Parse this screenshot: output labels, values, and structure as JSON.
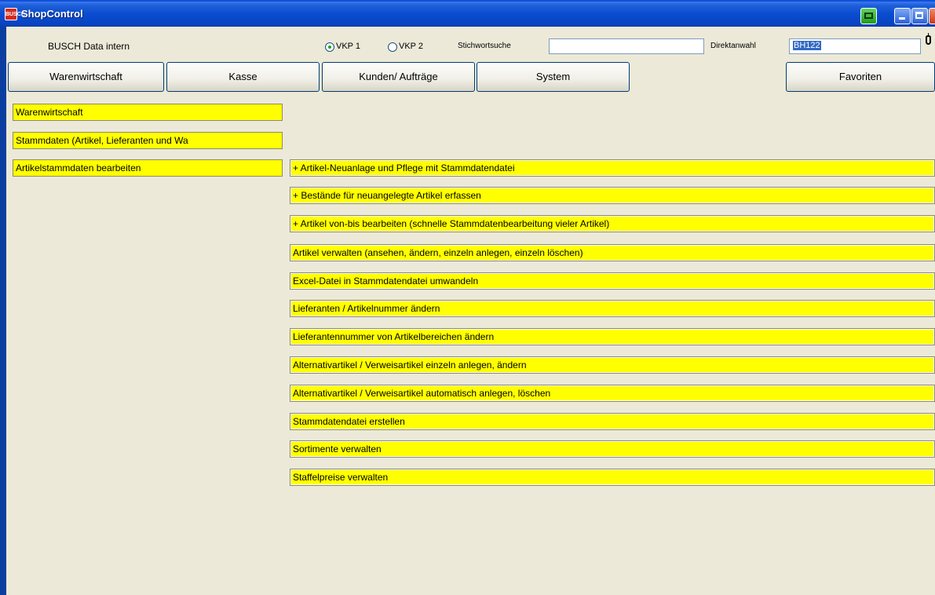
{
  "window": {
    "title": "ShopControl",
    "icon": "shopcontrol-app-icon",
    "app_icon_text": "BUSCH"
  },
  "header": {
    "company": "BUSCH Data intern",
    "price_options": [
      {
        "label": "VKP 1",
        "selected": true
      },
      {
        "label": "VKP 2",
        "selected": false
      }
    ],
    "search_label": "Stichwortsuche",
    "search_value": "",
    "direct_label": "Direktanwahl",
    "direct_value": "BH122"
  },
  "tabs": [
    "Warenwirtschaft",
    "Kasse",
    "Kunden/ Aufträge",
    "System",
    "Favoriten"
  ],
  "breadcrumb": [
    "Warenwirtschaft",
    "Stammdaten  (Artikel, Lieferanten und Wa",
    "Artikelstammdaten bearbeiten"
  ],
  "menu_items": [
    "+  Artikel-Neuanlage und Pflege mit Stammdatendatei",
    "+  Bestände für neuangelegte Artikel erfassen",
    "+  Artikel von-bis bearbeiten (schnelle Stammdatenbearbeitung vieler Artikel)",
    "Artikel verwalten (ansehen, ändern, einzeln anlegen, einzeln löschen)",
    "Excel-Datei in Stammdatendatei umwandeln",
    "Lieferanten / Artikelnummer ändern",
    "Lieferantennummer von Artikelbereichen ändern",
    "Alternativartikel / Verweisartikel einzeln anlegen, ändern",
    "Alternativartikel / Verweisartikel automatisch anlegen, löschen",
    "Stammdatendatei erstellen",
    "Sortimente verwalten",
    "Staffelpreise verwalten"
  ],
  "colors": {
    "titlebar": "#0a4cd0",
    "client_bg": "#ece9d8",
    "menu_bg": "#ffff00",
    "radio_dot": "#21a121"
  }
}
